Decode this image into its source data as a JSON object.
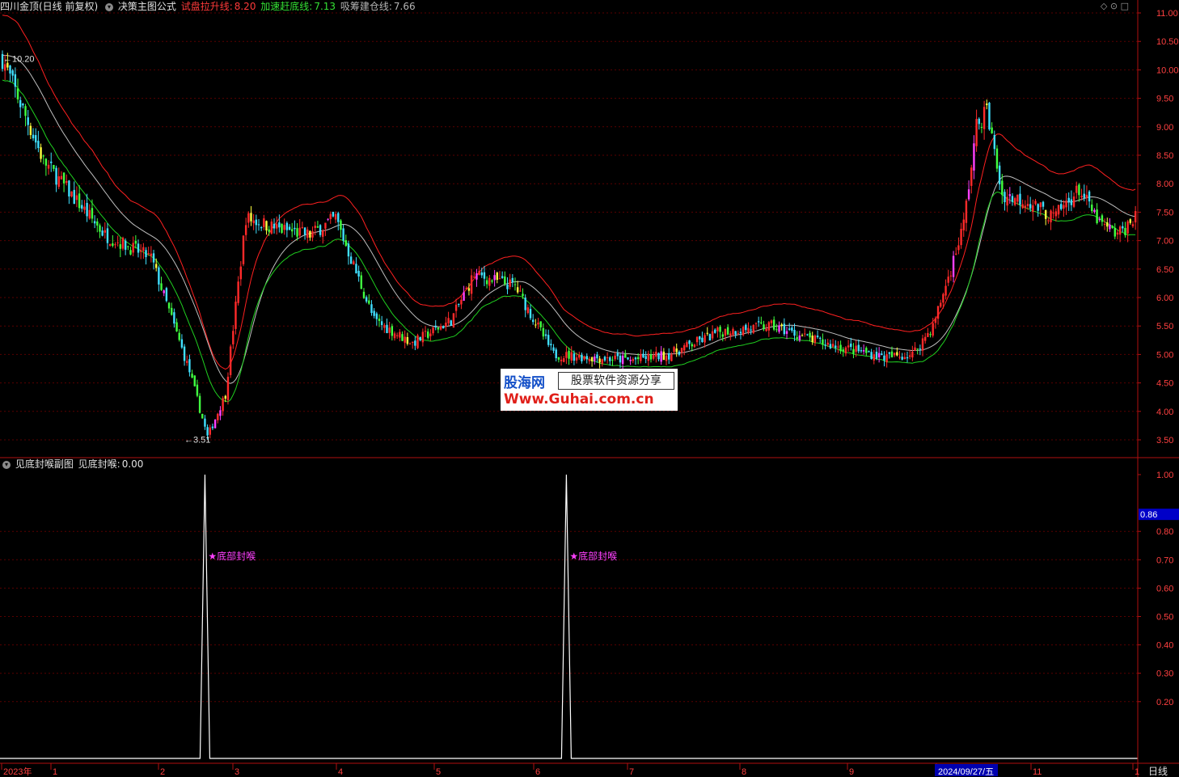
{
  "header_main": {
    "stock": "四川金顶(日线 前复权)",
    "formula": "决策主图公式",
    "ind1_label": "试盘拉升线:",
    "ind1_value": "8.20",
    "ind1_color": "#ff3a3a",
    "ind2_label": "加速赶底线:",
    "ind2_value": "7.13",
    "ind2_color": "#34e034",
    "ind3_label": "吸筹建仓线:",
    "ind3_value": "7.66",
    "ind3_color": "#b4b4b4"
  },
  "header_sub": {
    "formula": "见底封喉副图",
    "ind_label": "见底封喉:",
    "ind_value": "0.00"
  },
  "icons": [
    "diamond-icon",
    "circle-down-icon",
    "square-icon"
  ],
  "watermark": {
    "line1": "股海网",
    "line1b": "股票软件资源分享",
    "line2": "Www.Guhai.com.cn"
  },
  "bottom_right_label": "日线",
  "highlighted_date": "2024/09/27/五",
  "sub_current_value": "0.86",
  "chart_data": [
    {
      "type": "candlestick",
      "title": "四川金顶(日线 前复权)",
      "y_ticks": [
        "3.50",
        "4.00",
        "4.50",
        "5.00",
        "5.50",
        "6.00",
        "6.50",
        "7.00",
        "7.50",
        "8.00",
        "8.50",
        "9.00",
        "9.50",
        "10.00",
        "10.50",
        "11.00"
      ],
      "ylim": [
        3.3,
        11.1
      ],
      "x_labels": [
        "2023年",
        "1",
        "2",
        "3",
        "4",
        "5",
        "6",
        "7",
        "8",
        "9",
        "2024/09/27/五",
        "11",
        "1"
      ],
      "annotations": [
        {
          "text": "10.20",
          "price": 10.2
        },
        {
          "text": "3.51",
          "price": 3.51
        }
      ],
      "series": [
        {
          "name": "试盘拉升线",
          "color": "#ff2020",
          "last": 8.2
        },
        {
          "name": "吸筹建仓线",
          "color": "#bfbfbf",
          "last": 7.66
        },
        {
          "name": "加速赶底线",
          "color": "#20d020",
          "last": 7.13
        }
      ],
      "price_path_knots": [
        [
          0,
          10.2
        ],
        [
          16,
          8.4
        ],
        [
          40,
          7.1
        ],
        [
          58,
          6.7
        ],
        [
          73,
          4.7
        ],
        [
          80,
          3.55
        ],
        [
          87,
          4.3
        ],
        [
          95,
          7.4
        ],
        [
          108,
          7.2
        ],
        [
          120,
          7.1
        ],
        [
          130,
          7.4
        ],
        [
          145,
          5.6
        ],
        [
          160,
          5.2
        ],
        [
          175,
          5.6
        ],
        [
          184,
          6.4
        ],
        [
          200,
          6.2
        ],
        [
          215,
          5.0
        ],
        [
          245,
          4.9
        ],
        [
          260,
          5.0
        ],
        [
          280,
          5.4
        ],
        [
          300,
          5.5
        ],
        [
          320,
          5.2
        ],
        [
          345,
          4.95
        ],
        [
          355,
          5.0
        ],
        [
          363,
          5.5
        ],
        [
          370,
          6.5
        ],
        [
          375,
          7.3
        ],
        [
          380,
          9.0
        ],
        [
          384,
          9.3
        ],
        [
          390,
          7.8
        ],
        [
          400,
          7.7
        ],
        [
          410,
          7.4
        ],
        [
          420,
          7.9
        ],
        [
          428,
          7.3
        ],
        [
          435,
          7.1
        ],
        [
          440,
          7.3
        ],
        [
          442,
          7.5
        ]
      ]
    },
    {
      "type": "line",
      "title": "见底封喉副图",
      "y_ticks": [
        "0.20",
        "0.30",
        "0.40",
        "0.50",
        "0.60",
        "0.70",
        "0.80",
        "1.00"
      ],
      "ylim": [
        0,
        1.0
      ],
      "series": [
        {
          "name": "见底封喉",
          "color": "#ffffff",
          "spike_candles": [
            79,
            220
          ],
          "spike_value": 1.0
        }
      ],
      "annotations": [
        {
          "text": "★底部封喉",
          "candle": 79
        },
        {
          "text": "★底部封喉",
          "candle": 220
        }
      ]
    }
  ]
}
